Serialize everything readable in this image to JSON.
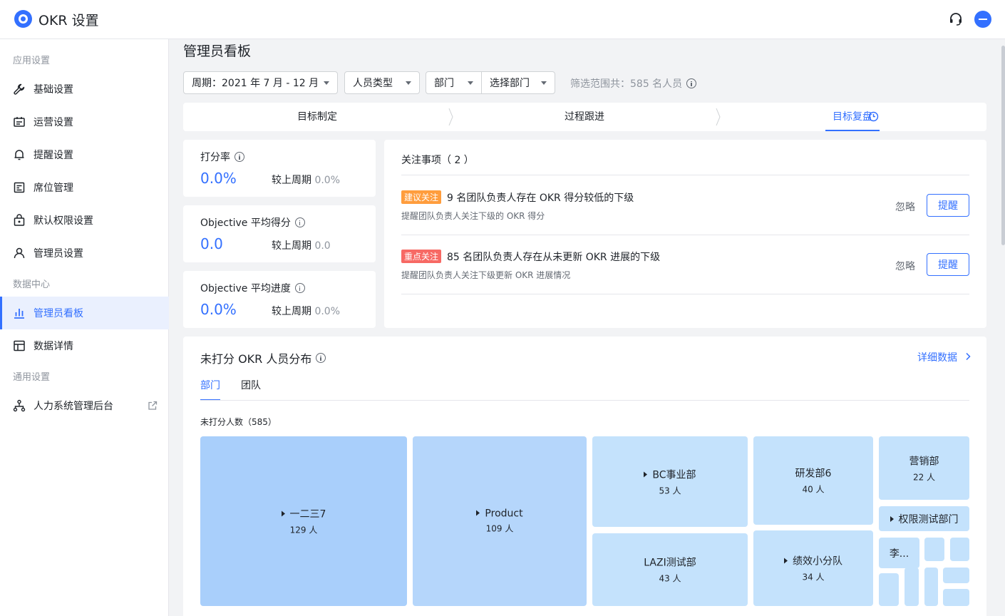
{
  "app": {
    "title": "OKR 设置"
  },
  "header": {
    "support_icon": "headset-icon",
    "avatar_icon": "avatar"
  },
  "sidebar": {
    "groups": [
      "应用设置",
      "数据中心",
      "通用设置"
    ],
    "items": [
      {
        "label": "基础设置",
        "icon": "wrench-icon"
      },
      {
        "label": "运营设置",
        "icon": "id-card-icon"
      },
      {
        "label": "提醒设置",
        "icon": "bell-icon"
      },
      {
        "label": "席位管理",
        "icon": "seat-icon"
      },
      {
        "label": "默认权限设置",
        "icon": "lock-icon"
      },
      {
        "label": "管理员设置",
        "icon": "user-icon"
      },
      {
        "label": "管理员看板",
        "icon": "bar-chart-icon",
        "active": true
      },
      {
        "label": "数据详情",
        "icon": "table-icon"
      },
      {
        "label": "人力系统管理后台",
        "icon": "org-icon"
      }
    ]
  },
  "main": {
    "page_title": "管理员看板",
    "filters": {
      "period": "周期：2021 年 7 月 - 12 月",
      "person_type": "人员类型",
      "dept": "部门",
      "choose_dept": "选择部门",
      "summary": "筛选范围共：585 名人员"
    },
    "steps": [
      "目标制定",
      "过程跟进",
      "目标复盘"
    ],
    "active_step": "目标复盘",
    "metrics": [
      {
        "label": "打分率",
        "value": "0.0%",
        "compare_label": "较上周期",
        "compare_value": "0.0%"
      },
      {
        "label": "Objective 平均得分",
        "value": "0.0",
        "compare_label": "较上周期",
        "compare_value": "0.0"
      },
      {
        "label": "Objective 平均进度",
        "value": "0.0%",
        "compare_label": "较上周期",
        "compare_value": "0.0%"
      }
    ],
    "attention": {
      "title": "关注事项（ 2 ）",
      "items": [
        {
          "tag": "建议关注",
          "tag_color": "#ff9d3d",
          "text": "9 名团队负责人存在 OKR 得分较低的下级",
          "sub": "提醒团队负责人关注下级的 OKR 得分",
          "ignore": "忽略",
          "remind": "提醒"
        },
        {
          "tag": "重点关注",
          "tag_color": "#f76964",
          "text": "85 名团队负责人存在从未更新 OKR 进展的下级",
          "sub": "提醒团队负责人关注下级更新 OKR 进展情况",
          "ignore": "忽略",
          "remind": "提醒"
        }
      ]
    },
    "distribution": {
      "title": "未打分 OKR 人员分布",
      "detail_link": "详细数据",
      "tabs": [
        "部门",
        "团队"
      ],
      "count_label": "未打分人数（585）",
      "colors": {
        "dark": "#a9cffb",
        "light": "#c4e2fc"
      },
      "blocks": [
        {
          "name": "一二三7",
          "count": "129 人",
          "expandable": true
        },
        {
          "name": "Product",
          "count": "109 人",
          "expandable": true
        },
        {
          "name": "BC事业部",
          "count": "53 人",
          "expandable": true
        },
        {
          "name": "LAZI测试部",
          "count": "43 人",
          "expandable": false
        },
        {
          "name": "研发部6",
          "count": "40 人",
          "expandable": false
        },
        {
          "name": "绩效小分队",
          "count": "34 人",
          "expandable": true
        },
        {
          "name": "营销部",
          "count": "22 人",
          "expandable": false
        },
        {
          "name": "权限测试部门",
          "count": "",
          "expandable": true
        },
        {
          "name": "李...",
          "count": "",
          "expandable": false
        }
      ]
    }
  }
}
